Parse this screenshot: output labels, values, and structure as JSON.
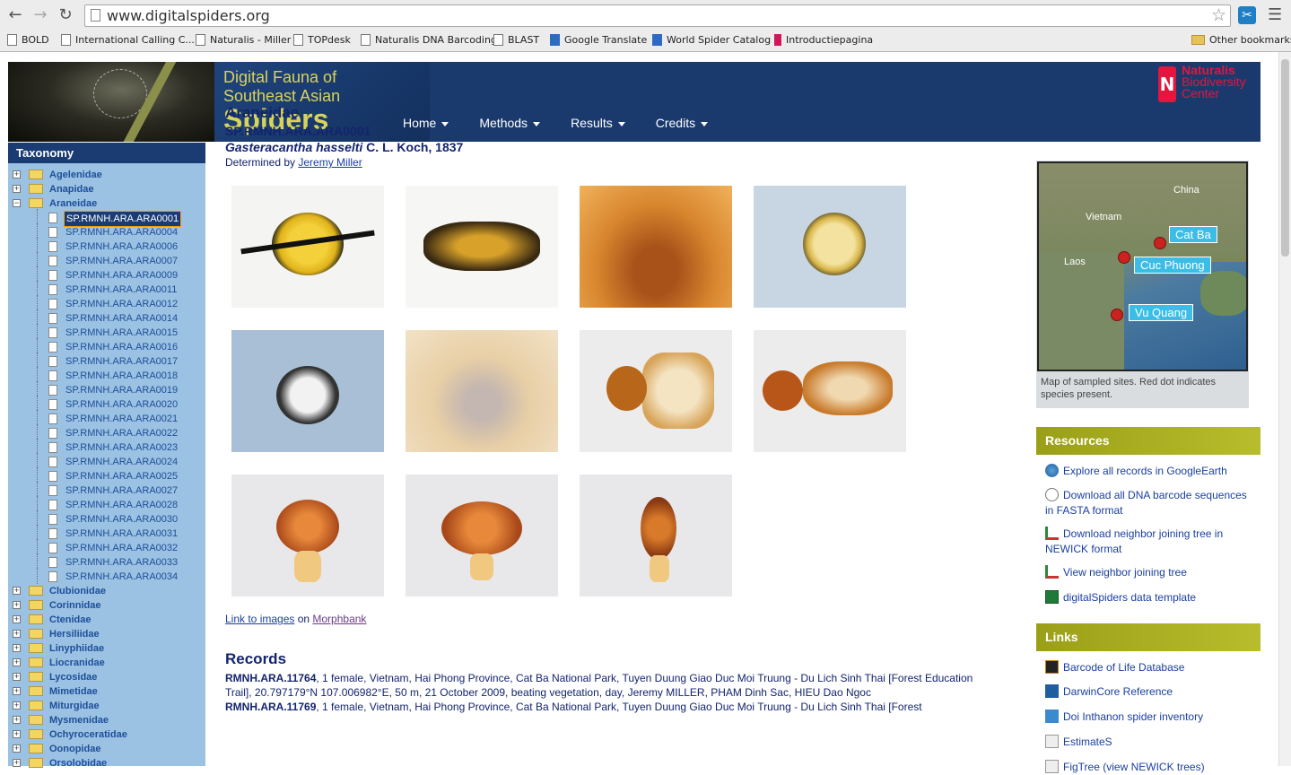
{
  "browser": {
    "url": "www.digitalspiders.org",
    "bookmarks": [
      "BOLD",
      "International Calling C...",
      "Naturalis - Miller",
      "TOPdesk",
      "Naturalis DNA Barcoding",
      "BLAST",
      "Google Translate",
      "World Spider Catalog",
      "Introductiepagina"
    ],
    "other_bookmarks": "Other bookmarks"
  },
  "site": {
    "title_line1": "Digital Fauna of",
    "title_line2": "Southeast Asian",
    "title_line3": "Spiders",
    "nav": [
      "Home",
      "Methods",
      "Results",
      "Credits"
    ],
    "logo_line1": "Naturalis",
    "logo_line2": "Biodiversity",
    "logo_line3": "Center"
  },
  "sidebar": {
    "heading": "Taxonomy",
    "families_before": [
      "Agelenidae",
      "Anapidae"
    ],
    "open_family": "Araneidae",
    "specimens": [
      "SP.RMNH.ARA.ARA0001",
      "SP.RMNH.ARA.ARA0004",
      "SP.RMNH.ARA.ARA0006",
      "SP.RMNH.ARA.ARA0007",
      "SP.RMNH.ARA.ARA0009",
      "SP.RMNH.ARA.ARA0011",
      "SP.RMNH.ARA.ARA0012",
      "SP.RMNH.ARA.ARA0014",
      "SP.RMNH.ARA.ARA0015",
      "SP.RMNH.ARA.ARA0016",
      "SP.RMNH.ARA.ARA0017",
      "SP.RMNH.ARA.ARA0018",
      "SP.RMNH.ARA.ARA0019",
      "SP.RMNH.ARA.ARA0020",
      "SP.RMNH.ARA.ARA0021",
      "SP.RMNH.ARA.ARA0022",
      "SP.RMNH.ARA.ARA0023",
      "SP.RMNH.ARA.ARA0024",
      "SP.RMNH.ARA.ARA0025",
      "SP.RMNH.ARA.ARA0027",
      "SP.RMNH.ARA.ARA0028",
      "SP.RMNH.ARA.ARA0030",
      "SP.RMNH.ARA.ARA0031",
      "SP.RMNH.ARA.ARA0032",
      "SP.RMNH.ARA.ARA0033",
      "SP.RMNH.ARA.ARA0034"
    ],
    "selected_specimen": "SP.RMNH.ARA.ARA0001",
    "families_after": [
      "Clubionidae",
      "Corinnidae",
      "Ctenidae",
      "Hersiliidae",
      "Linyphiidae",
      "Liocranidae",
      "Lycosidae",
      "Mimetidae",
      "Miturgidae",
      "Mysmenidae",
      "Ochyroceratidae",
      "Oonopidae",
      "Orsolobidae"
    ]
  },
  "main": {
    "family": "Araneidae",
    "specimen_id": "SP.RMNH.ARA.ARA0001",
    "species_italic": "Gasteracantha hasselti",
    "species_author": " C. L. Koch, 1837",
    "determined_prefix": "Determined by ",
    "determined_by": "Jeremy Miller",
    "link_images": "Link to images",
    "on_text": " on ",
    "morphbank": "Morphbank",
    "records_heading": "Records",
    "record1_id": "RMNH.ARA.11764",
    "record1_text": ", 1 female, Vietnam, Hai Phong Province, Cat Ba National Park, Tuyen Duung Giao Duc Moi Truung - Du Lich Sinh Thai [Forest Education Trail], 20.797179°N 107.006982°E, 50 m, 21 October 2009, beating vegetation, day, Jeremy MILLER, PHAM Dinh Sac, HIEU Dao Ngoc",
    "record2_id": "RMNH.ARA.11769",
    "record2_text": ", 1 female, Vietnam, Hai Phong Province, Cat Ba National Park, Tuyen Duung Giao Duc Moi Truung - Du Lich Sinh Thai [Forest"
  },
  "map": {
    "labels": [
      "China",
      "Vietnam",
      "Laos"
    ],
    "sites": [
      "Cat Ba",
      "Cuc Phuong",
      "Vu Quang"
    ],
    "caption": "Map of sampled sites. Red dot indicates species present."
  },
  "resources": {
    "heading": "Resources",
    "items": [
      "Explore all records in GoogleEarth",
      "Download all DNA barcode sequences in FASTA format",
      "Download neighbor joining tree in NEWICK format",
      "View neighbor joining tree",
      "digitalSpiders data template"
    ]
  },
  "links": {
    "heading": "Links",
    "items": [
      "Barcode of Life Database",
      "DarwinCore Reference",
      "Doi Inthanon spider inventory",
      "EstimateS",
      "FigTree (view NEWICK trees)"
    ]
  },
  "colors": {
    "header_blue": "#1a3a6e",
    "sidebar_blue": "#9bc2e2",
    "olive": "#9a9f17",
    "link": "#1a3fa0"
  }
}
